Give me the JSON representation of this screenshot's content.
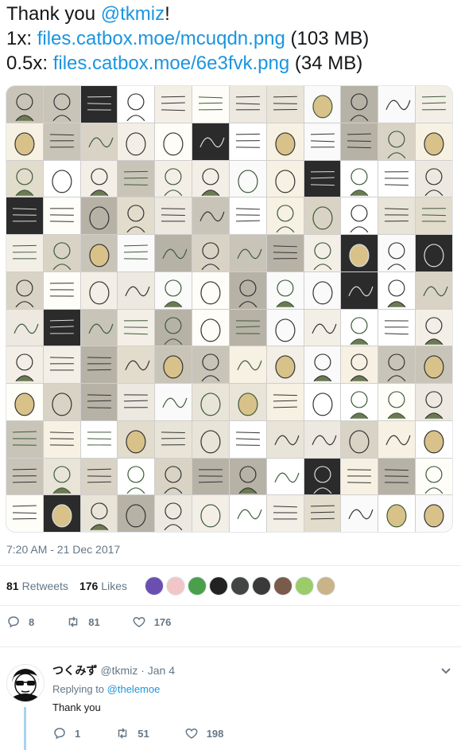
{
  "tweet": {
    "line1_prefix": "Thank you ",
    "mention": "@tkmiz",
    "line1_suffix": "!",
    "line2_prefix": "1x: ",
    "link1": "files.catbox.moe/mcuqdn.png",
    "line2_suffix": " (103 MB)",
    "line3_prefix": "0.5x: ",
    "link2": "files.catbox.moe/6e3fvk.png",
    "line3_suffix": " (34 MB)"
  },
  "timestamp": "7:20 AM - 21 Dec 2017",
  "stats": {
    "retweets_count": "81",
    "retweets_label": "Retweets",
    "likes_count": "176",
    "likes_label": "Likes"
  },
  "actions": {
    "reply_count": "8",
    "retweet_count": "81",
    "like_count": "176"
  },
  "reply": {
    "name": "つくみず",
    "handle": "@tkmiz",
    "date": "· Jan 4",
    "replying_label": "Replying to ",
    "replying_to": "@thelemoe",
    "text": "Thank you",
    "reply_count": "1",
    "retweet_count": "51",
    "like_count": "198"
  },
  "icons": {
    "reply": "reply-icon",
    "retweet": "retweet-icon",
    "like": "heart-icon",
    "caret": "chevron-down-icon"
  },
  "colors": {
    "link": "#1b95e0",
    "muted": "#657786",
    "thread": "#a6d4f2"
  }
}
